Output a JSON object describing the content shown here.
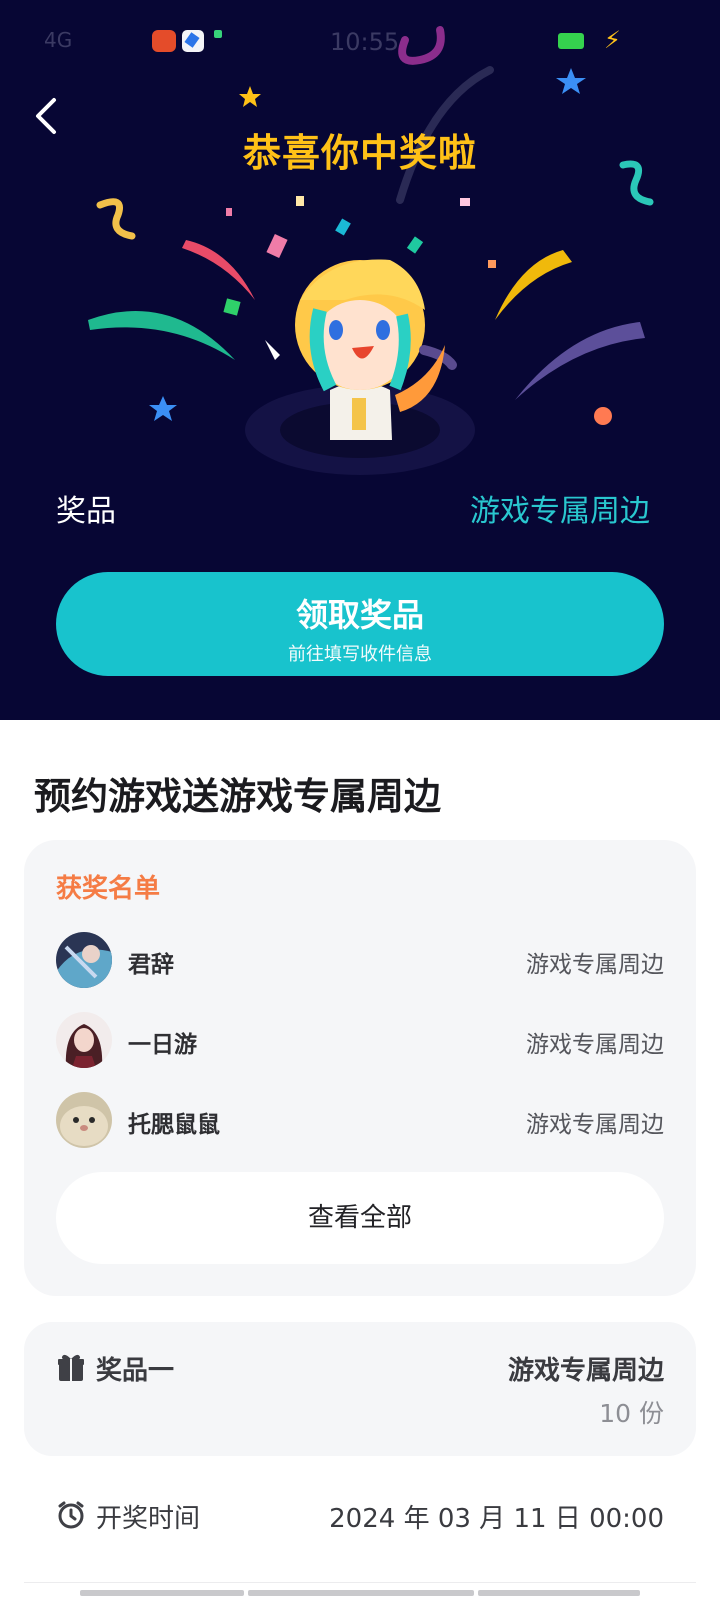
{
  "status_bar": {
    "time": "10:55",
    "left_text": "4G",
    "bolt": "⚡"
  },
  "hero": {
    "title": "恭喜你中奖啦",
    "prize_label": "奖品",
    "prize_value": "游戏专属周边"
  },
  "claim_button": {
    "title": "领取奖品",
    "subtitle": "前往填写收件信息"
  },
  "event": {
    "title": "预约游戏送游戏专属周边"
  },
  "winners": {
    "heading": "获奖名单",
    "rows": [
      {
        "name": "君辞",
        "prize": "游戏专属周边"
      },
      {
        "name": "一日游",
        "prize": "游戏专属周边"
      },
      {
        "name": "托腮鼠鼠",
        "prize": "游戏专属周边"
      }
    ],
    "view_all_label": "查看全部"
  },
  "prize_info": {
    "label": "奖品一",
    "name": "游戏专属周边",
    "quantity": "10 份"
  },
  "draw_time": {
    "label": "开奖时间",
    "value": "2024 年 03 月 11 日 00:00"
  },
  "colors": {
    "hero_bg": "#070634",
    "accent_teal": "#18c3cd",
    "title_gold": "#ffc117",
    "heading_orange": "#f57c45"
  },
  "icons": {
    "back": "chevron-left-icon",
    "gift": "gift-icon",
    "clock": "alarm-clock-icon"
  }
}
